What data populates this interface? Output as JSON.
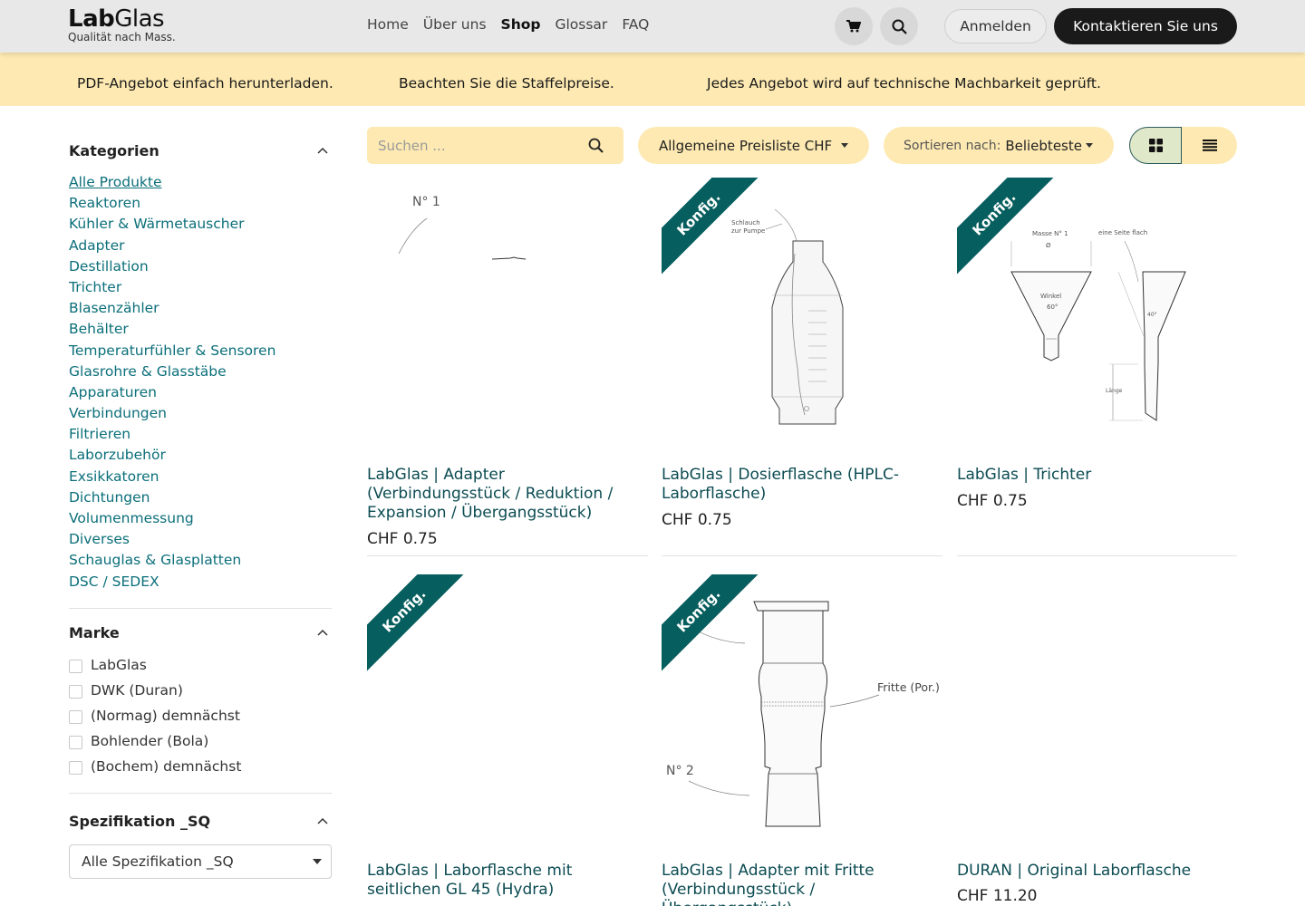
{
  "logo": {
    "bold": "Lab",
    "light": "Glas",
    "tagline": "Qualität nach Mass."
  },
  "nav": [
    "Home",
    "Über uns",
    "Shop",
    "Glossar",
    "FAQ"
  ],
  "nav_active": "Shop",
  "header": {
    "cart_icon": "cart-icon",
    "search_icon": "search-icon",
    "login": "Anmelden",
    "contact": "Kontaktieren Sie uns"
  },
  "banner": [
    "PDF-Angebot einfach herunterladen.",
    "Beachten Sie die Staffelpreise.",
    "Jedes Angebot wird auf technische Machbarkeit geprüft."
  ],
  "sidebar": {
    "categories_title": "Kategorien",
    "categories": [
      "Alle Produkte",
      "Reaktoren",
      "Kühler & Wärmetauscher",
      "Adapter",
      "Destillation",
      "Trichter",
      "Blasenzähler",
      "Behälter",
      "Temperaturfühler & Sensoren",
      "Glasrohre & Glasstäbe",
      "Apparaturen",
      "Verbindungen",
      "Filtrieren",
      "Laborzubehör",
      "Exsikkatoren",
      "Dichtungen",
      "Volumenmessung",
      "Diverses",
      "Schauglas & Glasplatten",
      "DSC / SEDEX"
    ],
    "brand_title": "Marke",
    "brands": [
      "LabGlas",
      "DWK (Duran)",
      "(Normag) demnächst",
      "Bohlender (Bola)",
      "(Bochem) demnächst"
    ],
    "spec_title": "Spezifikation _SQ",
    "spec_value": "Alle Spezifikation _SQ"
  },
  "toolbar": {
    "search_placeholder": "Suchen ...",
    "pricelist": "Allgemeine Preisliste CHF",
    "sort_label": "Sortieren nach:",
    "sort_value": "Beliebteste"
  },
  "products": [
    {
      "title": "LabGlas | Adapter (Verbindungsstück / Reduktion / Expansion / Übergangsstück)",
      "price": "CHF 0.75",
      "ribbon": "",
      "drawing_labels": [
        "N° 1"
      ]
    },
    {
      "title": "LabGlas | Dosierflasche (HPLC-Laborflasche)",
      "price": "CHF 0.75",
      "ribbon": "Konfig.",
      "drawing_labels": [
        "Schlauch",
        "zur Pumpe"
      ]
    },
    {
      "title": "LabGlas | Trichter",
      "price": "CHF 0.75",
      "ribbon": "Konfig.",
      "drawing_labels": [
        "Masse N° 1",
        "Ø",
        "eine Seite flach",
        "Winkel",
        "60°",
        "40°",
        "Länge"
      ]
    },
    {
      "title": "LabGlas | Laborflasche mit seitlichen GL 45 (Hydra)",
      "price": "",
      "ribbon": "Konfig.",
      "drawing_labels": []
    },
    {
      "title": "LabGlas | Adapter mit Fritte (Verbindungsstück / Übergangsstück)",
      "price": "",
      "ribbon": "Konfig.",
      "drawing_labels": [
        "Fritte (Por.)",
        "N° 2"
      ]
    },
    {
      "title": "DURAN | Original Laborflasche",
      "price": "CHF 11.20",
      "ribbon": "",
      "drawing_labels": []
    }
  ]
}
